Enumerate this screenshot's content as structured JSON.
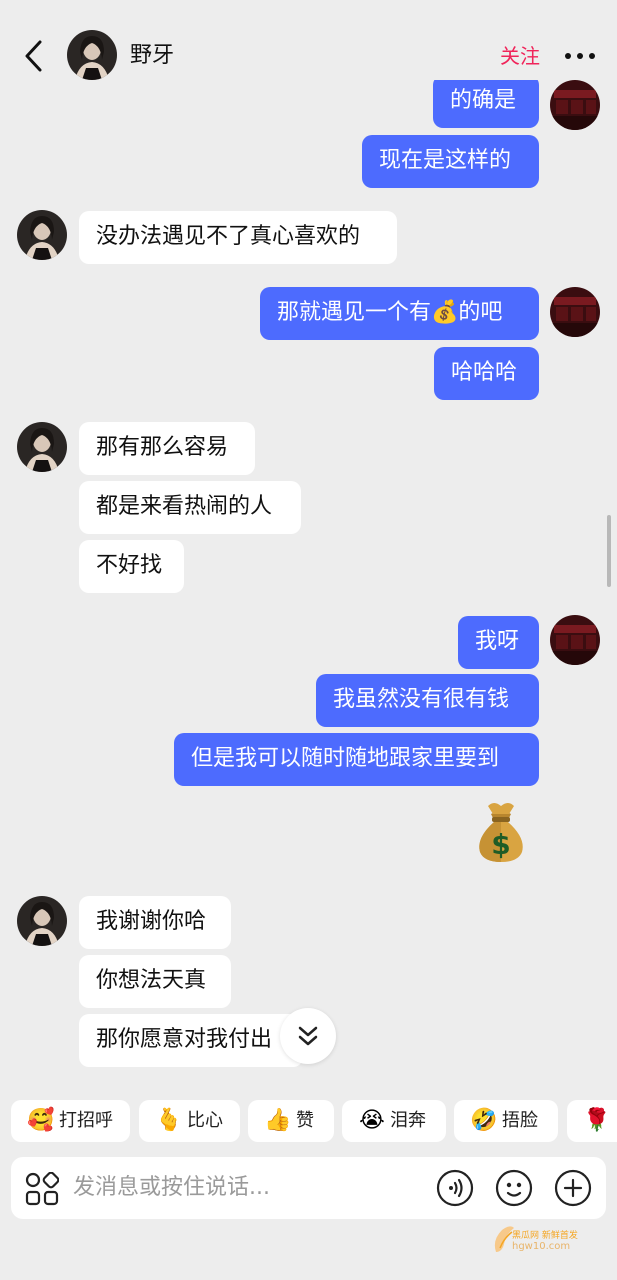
{
  "header": {
    "name": "野牙",
    "follow_label": "关注",
    "back_icon": "chevron-left-icon",
    "more_icon": "more-dots-icon"
  },
  "messages": [
    {
      "side": "out",
      "text": "的确是"
    },
    {
      "side": "out",
      "text": "现在是这样的"
    },
    {
      "side": "in",
      "text": "没办法遇见不了真心喜欢的"
    },
    {
      "side": "out",
      "text_before": "那就遇见一个有",
      "emoji": "💰",
      "text_after": "的吧"
    },
    {
      "side": "out",
      "text": "哈哈哈"
    },
    {
      "side": "in",
      "text": "那有那么容易"
    },
    {
      "side": "in",
      "text": "都是来看热闹的人"
    },
    {
      "side": "in",
      "text": "不好找"
    },
    {
      "side": "out",
      "text": "我呀"
    },
    {
      "side": "out",
      "text": "我虽然没有很有钱"
    },
    {
      "side": "out",
      "text": "但是我可以随时随地跟家里要到"
    },
    {
      "side": "out",
      "sticker": "💰"
    },
    {
      "side": "in",
      "text": "我谢谢你哈"
    },
    {
      "side": "in",
      "text": "你想法天真"
    },
    {
      "side": "in",
      "text": "那你愿意对我付出"
    }
  ],
  "quick_replies": [
    {
      "emoji": "🥰",
      "label": "打招呼"
    },
    {
      "emoji": "🫰",
      "label": "比心"
    },
    {
      "emoji": "👍",
      "label": "赞"
    },
    {
      "emoji": "😭",
      "label": "泪奔"
    },
    {
      "emoji": "🤣",
      "label": "捂脸"
    },
    {
      "emoji": "🌹",
      "label": ""
    }
  ],
  "composer": {
    "placeholder": "发消息或按住说话...",
    "apps_icon": "apps-grid-icon",
    "voice_icon": "voice-icon",
    "emoji_icon": "emoji-face-icon",
    "plus_icon": "plus-icon"
  },
  "watermark": {
    "line1": "黑瓜网 新鲜首发",
    "line2": "hgw10.com"
  },
  "colors": {
    "background": "#ededed",
    "outgoing_bubble": "#4d6bfe",
    "incoming_bubble": "#ffffff",
    "follow": "#f0245a"
  }
}
